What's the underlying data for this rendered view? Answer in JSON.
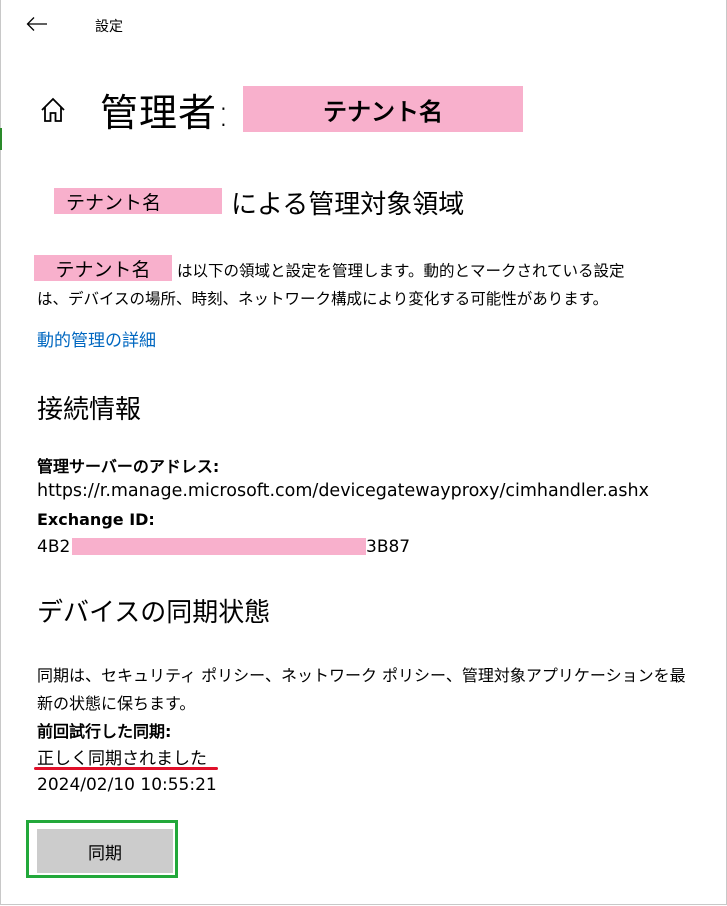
{
  "window": {
    "app_title": "設定"
  },
  "header": {
    "title_prefix": "管理者:",
    "tenant_placeholder": "テナント名"
  },
  "managed_area": {
    "tenant_placeholder": "テナント名",
    "heading": "による管理対象領域",
    "desc_tenant_placeholder": "テナント名",
    "desc_line1": "は以下の領域と設定を管理します。動的とマークされている設定",
    "desc_line2": "は、デバイスの場所、時刻、ネットワーク構成により変化する可能性があります。",
    "link_label": "動的管理の詳細"
  },
  "connection": {
    "heading": "接続情報",
    "server_label": "管理サーバーのアドレス:",
    "server_value": "https://r.manage.microsoft.com/devicegatewayproxy/cimhandler.ashx",
    "exchange_label": "Exchange ID:",
    "exchange_id_prefix": "4B2",
    "exchange_id_suffix": "3B87"
  },
  "sync": {
    "heading": "デバイスの同期状態",
    "desc_line1": "同期は、セキュリティ ポリシー、ネットワーク ポリシー、管理対象アプリケーションを最",
    "desc_line2": "新の状態に保ちます。",
    "last_label": "前回試行した同期:",
    "status": "正しく同期されました",
    "timestamp": "2024/02/10 10:55:21",
    "button_label": "同期"
  },
  "colors": {
    "link": "#0067c0",
    "redaction_mask": "#f8b0cc",
    "status_underline": "#e0102a",
    "button_highlight": "#22a83a",
    "button_bg": "#cccccc"
  },
  "icons": {
    "back": "arrow-left-icon",
    "home": "home-icon"
  }
}
